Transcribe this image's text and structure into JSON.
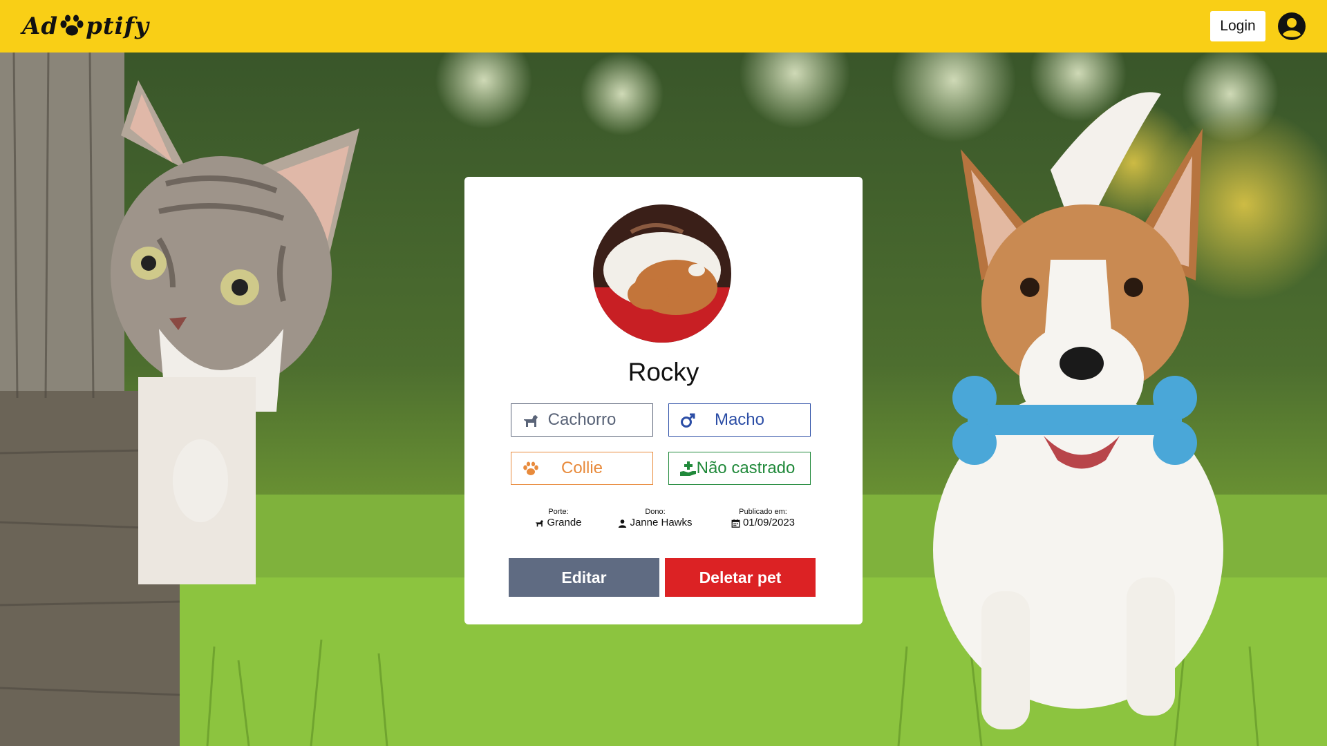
{
  "header": {
    "logo_text_left": "Ad",
    "logo_text_right": "ptify",
    "login_label": "Login",
    "brand_color": "#f9cf16"
  },
  "pet": {
    "name": "Rocky",
    "species": "Cachorro",
    "gender": "Macho",
    "breed": "Collie",
    "neutered": "Não castrado",
    "size_label": "Porte:",
    "size_value": "Grande",
    "owner_label": "Dono:",
    "owner_value": "Janne Hawks",
    "published_label": "Publicado em:",
    "published_value": "01/09/2023"
  },
  "actions": {
    "edit_label": "Editar",
    "delete_label": "Deletar pet"
  },
  "icons": {
    "species": "dog-icon",
    "gender": "mars-icon",
    "breed": "paw-icon",
    "neutered": "hand-holding-medical-icon",
    "size": "dog-icon",
    "owner": "user-icon",
    "date": "calendar-icon",
    "profile": "user-circle-icon"
  },
  "colors": {
    "species": "#5a6478",
    "gender": "#2c4ea6",
    "breed": "#e88a3b",
    "neutered": "#20893a",
    "edit": "#5f6b82",
    "delete": "#dc2224"
  }
}
